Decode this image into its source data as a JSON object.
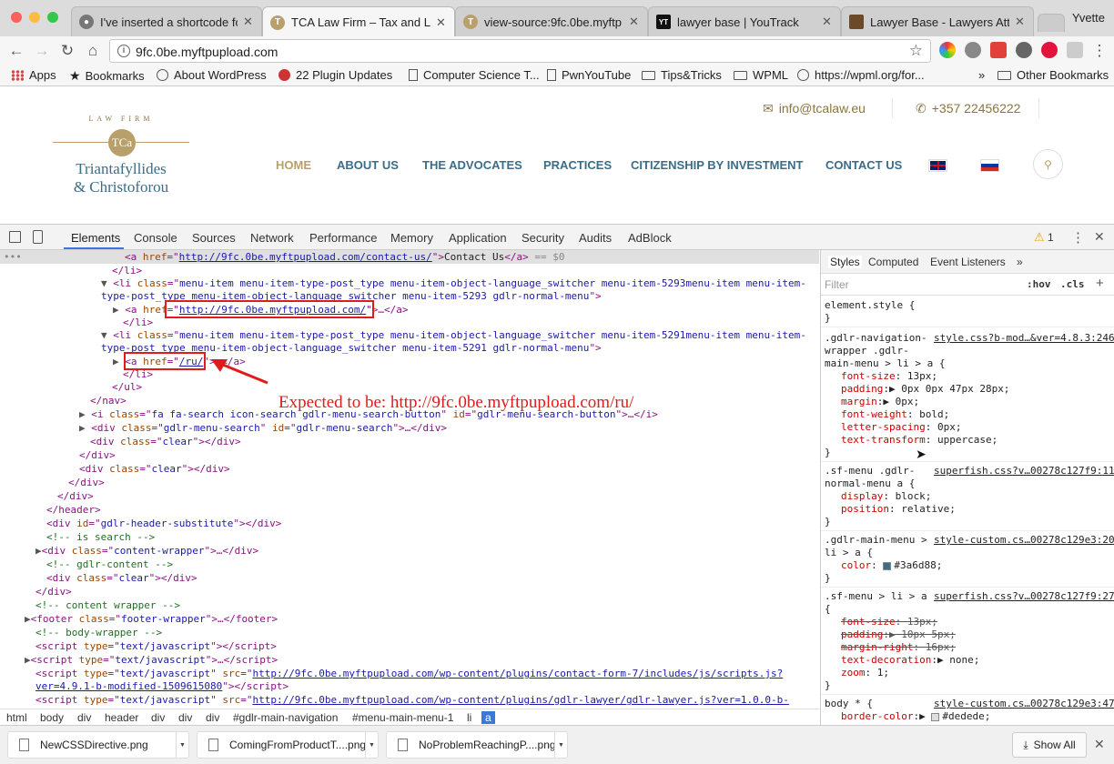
{
  "browser": {
    "profile_name": "Yvette",
    "tabs": [
      {
        "title": "I've inserted a shortcode fo"
      },
      {
        "title": "TCA Law Firm – Tax and Leg"
      },
      {
        "title": "view-source:9fc.0be.myftp"
      },
      {
        "title": "lawyer base | YouTrack"
      },
      {
        "title": "Lawyer Base - Lawyers Atto"
      }
    ],
    "url": "9fc.0be.myftpupload.com",
    "bookmarks": [
      {
        "label": "Apps",
        "icon": "apps-grid-icon"
      },
      {
        "label": "Bookmarks",
        "icon": "star-icon"
      },
      {
        "label": "About WordPress",
        "icon": "wordpress-icon"
      },
      {
        "label": "22 Plugin Updates",
        "icon": "plugin-icon"
      },
      {
        "label": "Computer Science T...",
        "icon": "page-icon"
      },
      {
        "label": "PwnYouTube",
        "icon": "page-icon"
      },
      {
        "label": "Tips&Tricks",
        "icon": "folder-icon"
      },
      {
        "label": "WPML",
        "icon": "folder-icon"
      },
      {
        "label": "https://wpml.org/for...",
        "icon": "globe-icon"
      },
      {
        "label": "Other Bookmarks",
        "icon": "folder-icon"
      }
    ],
    "bookmarks_overflow": "»"
  },
  "site": {
    "email": "info@tcalaw.eu",
    "phone": "+357 22456222",
    "logo": {
      "top": "LAW FIRM",
      "line1": "Triantafyllides",
      "line2": "& Christoforou",
      "monogram": "TCa"
    },
    "menu": [
      "HOME",
      "ABOUT US",
      "THE ADVOCATES",
      "PRACTICES",
      "CITIZENSHIP BY INVESTMENT",
      "CONTACT US"
    ]
  },
  "devtools": {
    "tabs": [
      "Elements",
      "Console",
      "Sources",
      "Network",
      "Performance",
      "Memory",
      "Application",
      "Security",
      "Audits",
      "AdBlock"
    ],
    "warning_count": "1",
    "annotation": "Expected to be:  http://9fc.0be.myftpupload.com/ru/",
    "breadcrumbs": [
      "html",
      "body",
      "div",
      "header",
      "div",
      "div",
      "div",
      "#gdlr-main-navigation",
      "#menu-main-menu-1",
      "li",
      "a"
    ],
    "styles_tabs": [
      "Styles",
      "Computed",
      "Event Listeners",
      "»"
    ],
    "filter_placeholder": "Filter",
    "filter_hov": ":hov",
    "filter_cls": ".cls"
  },
  "downloads": {
    "items": [
      "NewCSSDirective.png",
      "ComingFromProductT....png",
      "NoProblemReachingP....png"
    ],
    "show_all": "Show All"
  }
}
